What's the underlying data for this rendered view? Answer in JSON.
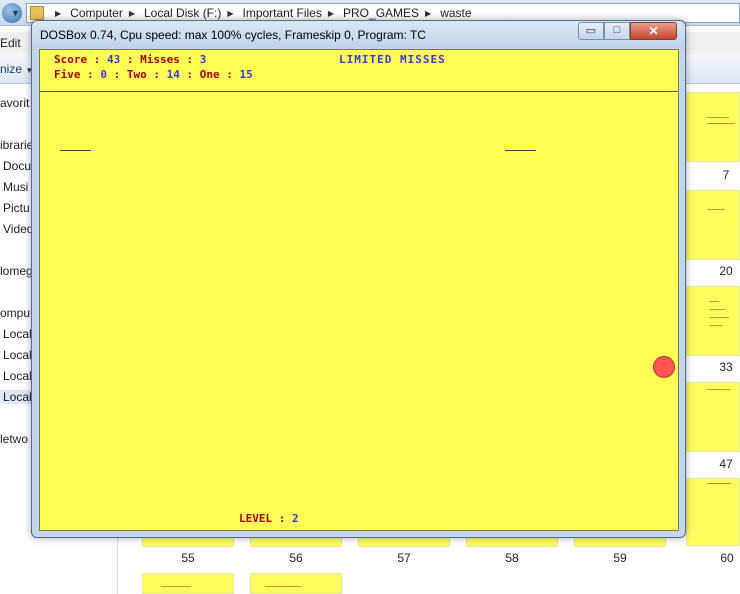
{
  "explorer": {
    "breadcrumbs": [
      "Computer",
      "Local Disk (F:)",
      "Important Files",
      "PRO_GAMES",
      "waste"
    ],
    "menu_edit": "Edit",
    "organize": "nize",
    "nav_items": [
      "avorit",
      "ibrarie",
      "Docu",
      "Musi",
      "Pictu",
      "Video",
      "lomeg",
      "ompu",
      "Local",
      "Local",
      "Local",
      "Local",
      "letwo"
    ],
    "right_thumb_numbers": [
      "7",
      "20",
      "33",
      "47"
    ],
    "bottom_thumb_numbers": [
      "55",
      "56",
      "57",
      "58",
      "59",
      "60"
    ]
  },
  "dosbox": {
    "title": "DOSBox 0.74, Cpu speed: max 100% cycles, Frameskip  0, Program:     TC",
    "close_glyph": "✕",
    "min_glyph": "▭",
    "max_glyph": "□"
  },
  "game": {
    "score_label": "Score : ",
    "score": "43",
    "misses_label": " : Misses : ",
    "misses": "3",
    "mode": "LIMITED MISSES",
    "five_label": "Five : ",
    "five": "0",
    "two_label": " : Two : ",
    "two": "14",
    "one_label": " : One : ",
    "one": "15",
    "level_label": "LEVEL : ",
    "level": "2"
  },
  "colors": {
    "game_background": "#ffff55",
    "label_red": "#aa0000",
    "value_blue": "#3a3ad8",
    "ball": "#ff5555"
  }
}
